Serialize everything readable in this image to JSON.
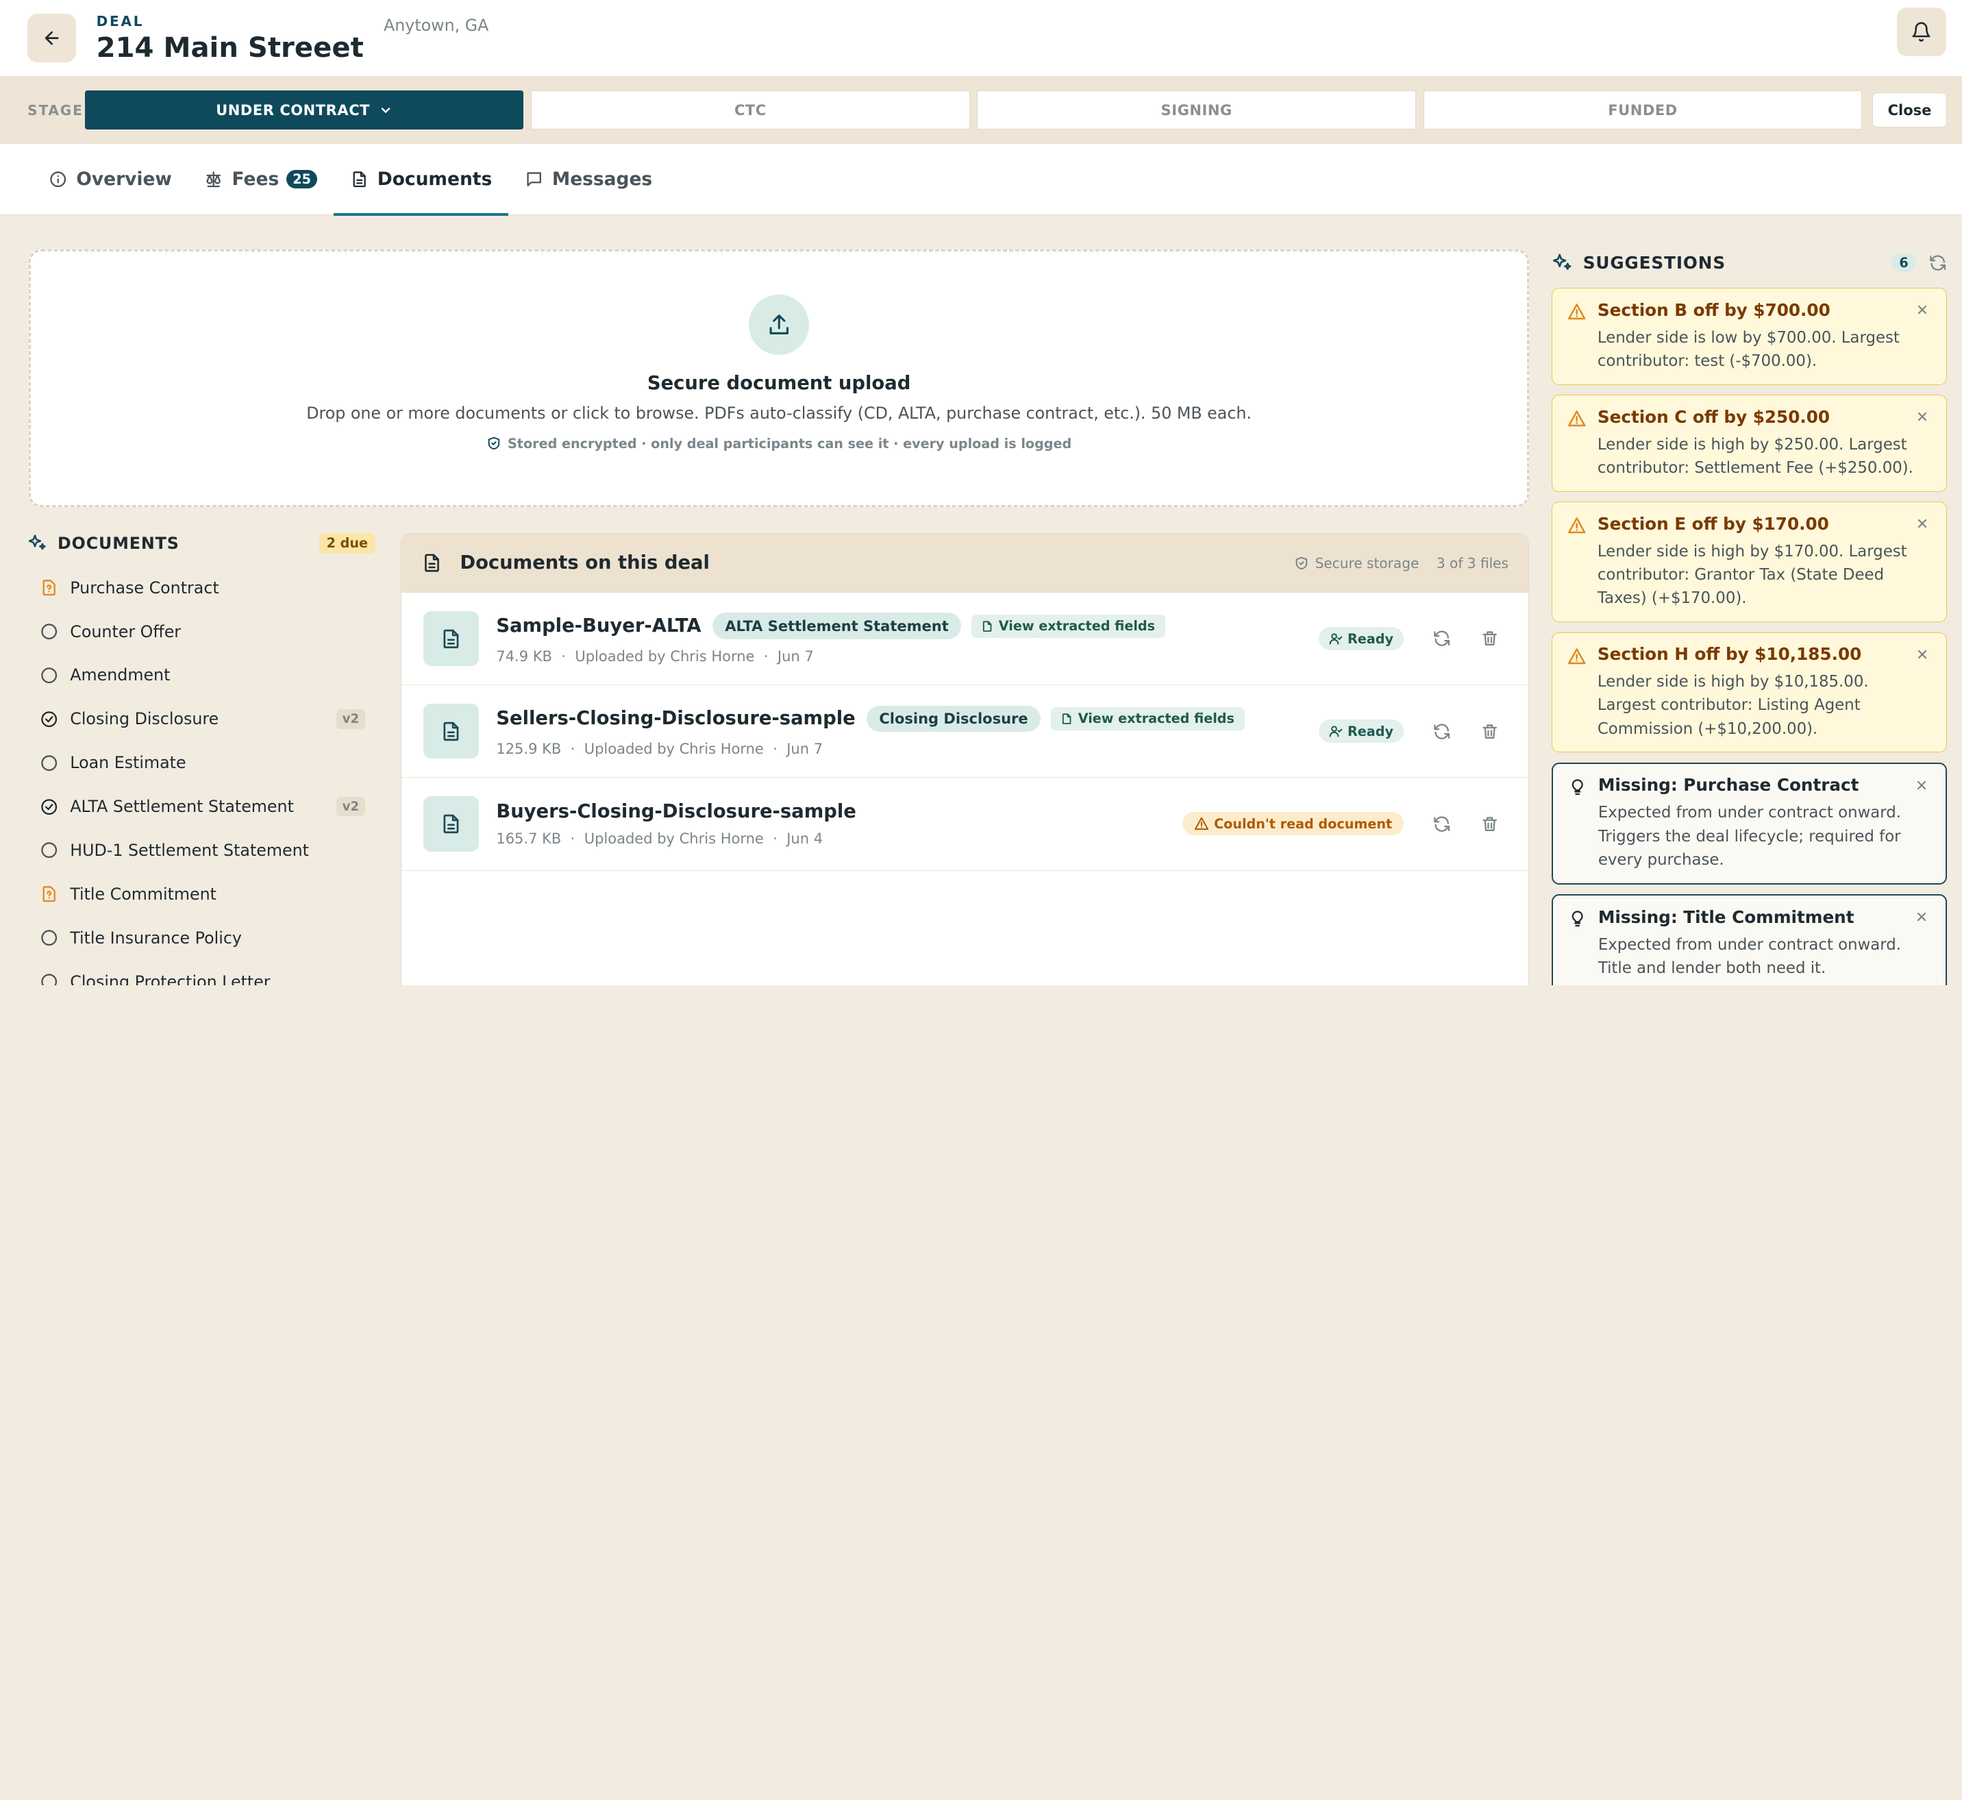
{
  "header": {
    "eyebrow": "DEAL",
    "title": "214 Main Streeet",
    "city": "Anytown, GA"
  },
  "stage": {
    "label": "STAGE",
    "segments": [
      "UNDER CONTRACT",
      "CTC",
      "SIGNING",
      "FUNDED"
    ],
    "active": "UNDER CONTRACT",
    "close_label": "Close"
  },
  "tabs": [
    {
      "label": "Overview"
    },
    {
      "label": "Fees",
      "badge": "25"
    },
    {
      "label": "Documents"
    },
    {
      "label": "Messages"
    }
  ],
  "upload": {
    "title": "Secure document upload",
    "description": "Drop one or more documents or click to browse. PDFs auto-classify (CD, ALTA, purchase contract, etc.). 50 MB each.",
    "note": "Stored encrypted · only deal participants can see it · every upload is logged"
  },
  "documents_sidebar": {
    "title": "DOCUMENTS",
    "due_label": "2 due",
    "items": [
      {
        "label": "Purchase Contract",
        "state": "due"
      },
      {
        "label": "Counter Offer",
        "state": "empty"
      },
      {
        "label": "Amendment",
        "state": "empty"
      },
      {
        "label": "Closing Disclosure",
        "state": "done",
        "version": "v2"
      },
      {
        "label": "Loan Estimate",
        "state": "empty"
      },
      {
        "label": "ALTA Settlement Statement",
        "state": "done",
        "version": "v2"
      },
      {
        "label": "HUD-1 Settlement Statement",
        "state": "empty"
      },
      {
        "label": "Title Commitment",
        "state": "due"
      },
      {
        "label": "Title Insurance Policy",
        "state": "empty"
      },
      {
        "label": "Closing Protection Letter",
        "state": "empty"
      }
    ]
  },
  "documents_panel": {
    "title": "Documents on this deal",
    "secure_label": "Secure storage",
    "count_label": "3 of 3 files",
    "view_fields_label": "View extracted fields",
    "files": [
      {
        "name": "Sample-Buyer-ALTA",
        "type": "ALTA Settlement Statement",
        "size": "74.9 KB",
        "uploader": "Uploaded by Chris Horne",
        "date": "Jun 7",
        "status": "Ready"
      },
      {
        "name": "Sellers-Closing-Disclosure-sample",
        "type": "Closing Disclosure",
        "size": "125.9 KB",
        "uploader": "Uploaded by Chris Horne",
        "date": "Jun 7",
        "status": "Ready"
      },
      {
        "name": "Buyers-Closing-Disclosure-sample",
        "type": "",
        "size": "165.7 KB",
        "uploader": "Uploaded by Chris Horne",
        "date": "Jun 4",
        "status": "Couldn't read document"
      }
    ]
  },
  "suggestions": {
    "title": "SUGGESTIONS",
    "count": "6",
    "cards": [
      {
        "kind": "warn",
        "title": "Section B off by $700.00",
        "body": "Lender side is low by $700.00. Largest contributor: test (-$700.00)."
      },
      {
        "kind": "warn",
        "title": "Section C off by $250.00",
        "body": "Lender side is high by $250.00. Largest contributor: Settlement Fee (+$250.00)."
      },
      {
        "kind": "warn",
        "title": "Section E off by $170.00",
        "body": "Lender side is high by $170.00. Largest contributor: Grantor Tax (State Deed Taxes) (+$170.00)."
      },
      {
        "kind": "warn",
        "title": "Section H off by $10,185.00",
        "body": "Lender side is high by $10,185.00. Largest contributor: Listing Agent Commission (+$10,200.00)."
      },
      {
        "kind": "info",
        "title": "Missing: Purchase Contract",
        "body": "Expected from under contract onward. Triggers the deal lifecycle; required for every purchase."
      },
      {
        "kind": "info",
        "title": "Missing: Title Commitment",
        "body": "Expected from under contract onward. Title and lender both need it."
      }
    ]
  },
  "colors": {
    "primary": "#0f4a5c",
    "accent": "#0f7a8f",
    "warn_border": "#ecc84c",
    "warn_title": "#7a3a00",
    "due_icon": "#e08a1e",
    "background": "#f2ebe0"
  }
}
